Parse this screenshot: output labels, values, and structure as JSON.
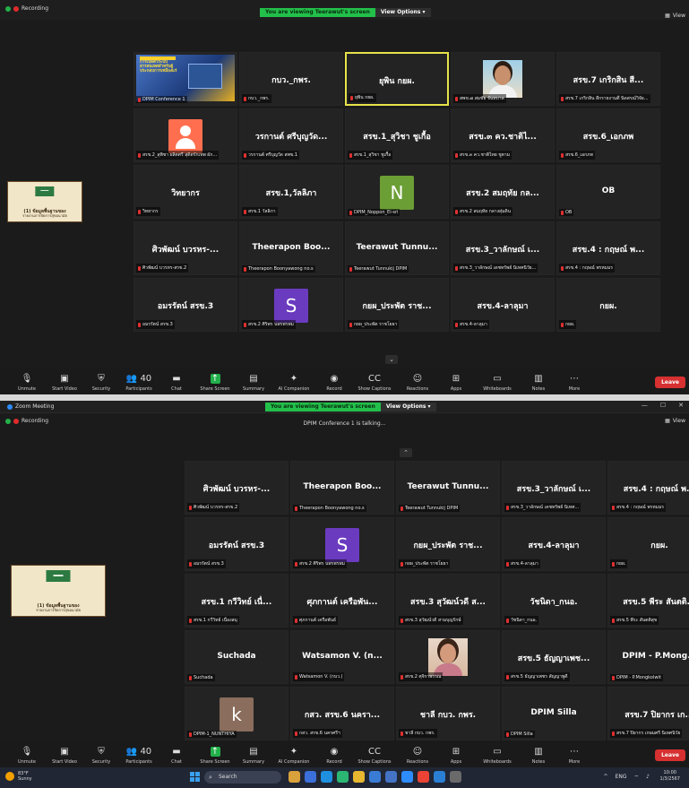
{
  "app": {
    "title": "Zoom Meeting"
  },
  "recording": {
    "label": "Recording"
  },
  "share_banner": {
    "viewing": "You are viewing Teerawut's screen",
    "view_options": "View Options"
  },
  "view_button": "View",
  "talking": "DPIM Conference 1 is talking...",
  "gallery_top": [
    {
      "kind": "poster",
      "name": "",
      "label": "DPIM Conference 1",
      "poster_text": "การเปิดตัวระบบสารสนเทศสำหรับผู้ประกอบการเหมืองแร่"
    },
    {
      "kind": "text",
      "name": "กบว._กพร.",
      "label": "กบว._กพร."
    },
    {
      "kind": "text",
      "name": "ยุพิน กยผ.",
      "label": "ยุพิน กยผ.",
      "active": true
    },
    {
      "kind": "photo",
      "name": "",
      "label": "สพข.๗ สมชัย จันทบาล"
    },
    {
      "kind": "text",
      "name": "สรข.7 เกริกสิน สี...",
      "label": "สรข.7 เกริกสิน สีกรายงานตึ นิดสรณ์วิจัย..."
    },
    {
      "kind": "avatar",
      "name": "",
      "label": "สรข.2_สุพิชา ผลิตศรี สุดิตรักเทพ ผัก...",
      "avatar_color": "#ff6f4f"
    },
    {
      "kind": "text",
      "name": "วรกานต์ ศรีบุญวัด...",
      "label": "วรกานต์ ศรีบุญวัด สพข.1"
    },
    {
      "kind": "text",
      "name": "สรข.1_สุวิชา ชูเกื้อ",
      "label": "สรข.1_สุวิชา ชูเกื้อ"
    },
    {
      "kind": "text",
      "name": "สรข.๓ คว.ชาติไ...",
      "label": "สรข.๓ คว.ชาติไทย ชูตาม"
    },
    {
      "kind": "text",
      "name": "สรข.6_เอกภพ",
      "label": "สรข.6_เอกภพ"
    },
    {
      "kind": "text",
      "name": "วิทยากร",
      "label": "วิทยากร"
    },
    {
      "kind": "text",
      "name": "สรข.1,วัลลิภา",
      "label": "สรข.1 วัลลิภา"
    },
    {
      "kind": "letter",
      "name": "",
      "letter": "N",
      "label": "DPIM_Noppon_Ei-sri",
      "avatar_color": "#6b9e35"
    },
    {
      "kind": "text",
      "name": "สรข.2 สมฤทัย กล...",
      "label": "สรข.2 สมฤทัย กลางสุ่มดิน"
    },
    {
      "kind": "text",
      "name": "OB",
      "label": "OB"
    },
    {
      "kind": "text",
      "name": "ศิวพัฒน์ บวรหร-...",
      "label": "ศิวพัฒน์ บวรหร-สรข.2"
    },
    {
      "kind": "text",
      "name": "Theerapon Boo...",
      "label": "Theerapon Boonyawong no.s"
    },
    {
      "kind": "text",
      "name": "Teerawut Tunnu...",
      "label": "Teerawut Tunnukij DPIM"
    },
    {
      "kind": "text",
      "name": "สรข.3_วาลักษณ์ เ...",
      "label": "สรข.3_วาลักษณ์ เดชทรัพย์ นิเทศนิวัย..."
    },
    {
      "kind": "text",
      "name": "สรข.4 : กฤษณ์ พ...",
      "label": "สรข.4 : กฤษณ์ พรหมมร"
    },
    {
      "kind": "text",
      "name": "อมรรัตน์ สรข.3",
      "label": "อมรรัตน์ สรข.3"
    },
    {
      "kind": "letter",
      "name": "",
      "letter": "S",
      "label": "สรข.2 ศิริพร นพรพรพม",
      "avatar_color": "#6a3bbf"
    },
    {
      "kind": "text",
      "name": "กยผ_ประพัต ราช...",
      "label": "กยผ_ประพัต ราชโยธา"
    },
    {
      "kind": "text",
      "name": "สรข.4-ลาลุมา",
      "label": "สรข.4-ลาลุมา"
    },
    {
      "kind": "text",
      "name": "กยผ.",
      "label": "กยผ."
    }
  ],
  "gallery_bottom": [
    {
      "kind": "text",
      "name": "ศิวพัฒน์ บวรหร-...",
      "label": "ศิวพัฒน์ บวรหร-สรข.2"
    },
    {
      "kind": "text",
      "name": "Theerapon Boo...",
      "label": "Theerapon Boonyawong no.s"
    },
    {
      "kind": "text",
      "name": "Teerawut Tunnu...",
      "label": "Teerawut Tunnukij DPIM"
    },
    {
      "kind": "text",
      "name": "สรข.3_วาลักษณ์ เ...",
      "label": "สรข.3_วาลักษณ์ เดชทรัพย์ นิเทศ..."
    },
    {
      "kind": "text",
      "name": "สรข.4 : กฤษณ์ พ...",
      "label": "สรข.4 : กฤษณ์ พรหมมร"
    },
    {
      "kind": "text",
      "name": "อมรรัตน์ สรข.3",
      "label": "อมรรัตน์ สรข.3"
    },
    {
      "kind": "letter",
      "name": "",
      "letter": "S",
      "label": "สรข.2 ศิริพร นพรพรพม",
      "avatar_color": "#6a3bbf"
    },
    {
      "kind": "text",
      "name": "กยผ_ประพัต ราช...",
      "label": "กยผ_ประพัต ราชโยธา"
    },
    {
      "kind": "text",
      "name": "สรข.4-ลาลุมา",
      "label": "สรข.4-ลาลุมา"
    },
    {
      "kind": "text",
      "name": "กยผ.",
      "label": "กยผ."
    },
    {
      "kind": "text",
      "name": "สรข.1 กวีวิทย์ เนื่...",
      "label": "สรข.1 กวีวิทย์ เนื่องสมุ"
    },
    {
      "kind": "text",
      "name": "ศุภกานต์ เครือพัน...",
      "label": "ศุภกานต์ เครือพันธ์"
    },
    {
      "kind": "text",
      "name": "สรข.3 สุวัฒน์วดี ส...",
      "label": "สรข.3 สุวัฒน์วดี สามบุญรักษ์"
    },
    {
      "kind": "text",
      "name": "วัชนิดา_กนอ.",
      "label": "วัชนิดา_กนอ."
    },
    {
      "kind": "text",
      "name": "สรข.5 พีระ สันตติ...",
      "label": "สรข.5 พีระ สันตติสุข"
    },
    {
      "kind": "text",
      "name": "Suchada",
      "label": "Suchada"
    },
    {
      "kind": "text",
      "name": "Watsamon V. (n...",
      "label": "Watsamon V. (กบว.)"
    },
    {
      "kind": "photo",
      "name": "",
      "label": "สรข.2 ศุจิราพรรณ"
    },
    {
      "kind": "text",
      "name": "สรข.5 ธัญญาเพช...",
      "label": "สรข.5 ธัญญาเพชร สัญญาพูดี"
    },
    {
      "kind": "text",
      "name": "DPIM - P.Mong...",
      "label": "DPIM - P.Mongkolwit"
    },
    {
      "kind": "letter",
      "name": "",
      "letter": "k",
      "label": "DPIM-1_NUNTHIYA",
      "avatar_color": "#8a6d5c"
    },
    {
      "kind": "text",
      "name": "กสว. สรข.6 นครา...",
      "label": "กสว. สรข.6 นครศรีฯ"
    },
    {
      "kind": "text",
      "name": "ชาลี กบว. กพร.",
      "label": "ชาลี กบว. กพร."
    },
    {
      "kind": "text",
      "name": "DPIM Silla",
      "label": "DPIM Silla"
    },
    {
      "kind": "text",
      "name": "สรข.7 ปิยากร เก...",
      "label": "สรข.7 ปิยากร เกษมศรี นิเทศนิวัย"
    }
  ],
  "side_share": {
    "title": "(1) ข้อมูลพื้นฐานของ",
    "subtitle": "รายงานการจัดการสุขอนามัย"
  },
  "toolbar": {
    "unmute": "Unmute",
    "start_video": "Start Video",
    "security": "Security",
    "participants": "Participants",
    "participants_count": "40",
    "chat": "Chat",
    "share_screen": "Share Screen",
    "summary": "Summary",
    "ai_companion": "AI Companion",
    "record": "Record",
    "show_captions": "Show Captions",
    "reactions": "Reactions",
    "apps": "Apps",
    "whiteboards": "Whiteboards",
    "notes": "Notes",
    "more": "More",
    "leave": "Leave"
  },
  "taskbar": {
    "temp": "83°F",
    "weather": "Sunny",
    "search": "Search",
    "lang": "ENG",
    "time": "10:00",
    "date": "1/3/2567"
  }
}
